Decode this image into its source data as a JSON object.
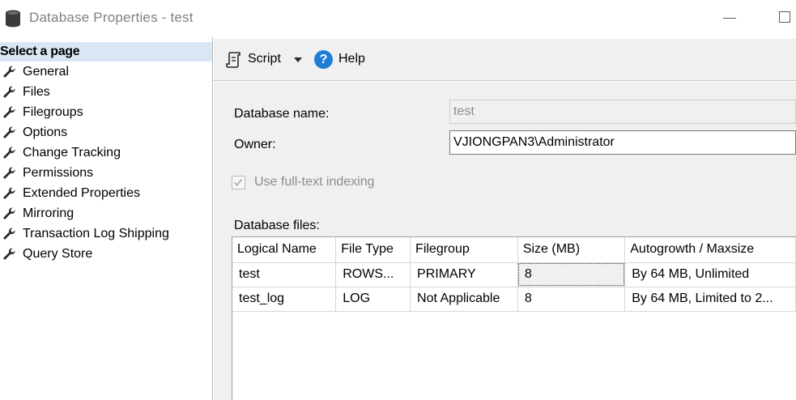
{
  "window": {
    "title": "Database Properties - test"
  },
  "pages": {
    "header": "Select a page",
    "items": [
      {
        "label": "General",
        "icon": "wrench-icon"
      },
      {
        "label": "Files",
        "icon": "wrench-icon"
      },
      {
        "label": "Filegroups",
        "icon": "wrench-icon"
      },
      {
        "label": "Options",
        "icon": "wrench-icon"
      },
      {
        "label": "Change Tracking",
        "icon": "wrench-icon"
      },
      {
        "label": "Permissions",
        "icon": "wrench-icon"
      },
      {
        "label": "Extended Properties",
        "icon": "wrench-icon"
      },
      {
        "label": "Mirroring",
        "icon": "wrench-icon"
      },
      {
        "label": "Transaction Log Shipping",
        "icon": "wrench-icon"
      },
      {
        "label": "Query Store",
        "icon": "wrench-icon"
      }
    ],
    "selected": "Files"
  },
  "toolbar": {
    "script_label": "Script",
    "help_label": "Help",
    "help_glyph": "?"
  },
  "form": {
    "database_name_label": "Database name:",
    "database_name_value": "test",
    "owner_label": "Owner:",
    "owner_value": "VJIONGPAN3\\Administrator",
    "fulltext_label": "Use full-text indexing",
    "fulltext_checked": true,
    "fulltext_enabled": false,
    "database_files_label": "Database files:"
  },
  "files_grid": {
    "columns": [
      "Logical Name",
      "File Type",
      "Filegroup",
      "Size (MB)",
      "Autogrowth / Maxsize"
    ],
    "rows": [
      [
        "test",
        "ROWS...",
        "PRIMARY",
        "8",
        "By 64 MB, Unlimited"
      ],
      [
        "test_log",
        "LOG",
        "Not Applicable",
        "8",
        "By 64 MB, Limited to 2..."
      ]
    ]
  },
  "colors": {
    "page_header_bg": "#d9e6f3",
    "panel_bg": "#f0f0f0",
    "help_icon": "#1e7ed4"
  }
}
